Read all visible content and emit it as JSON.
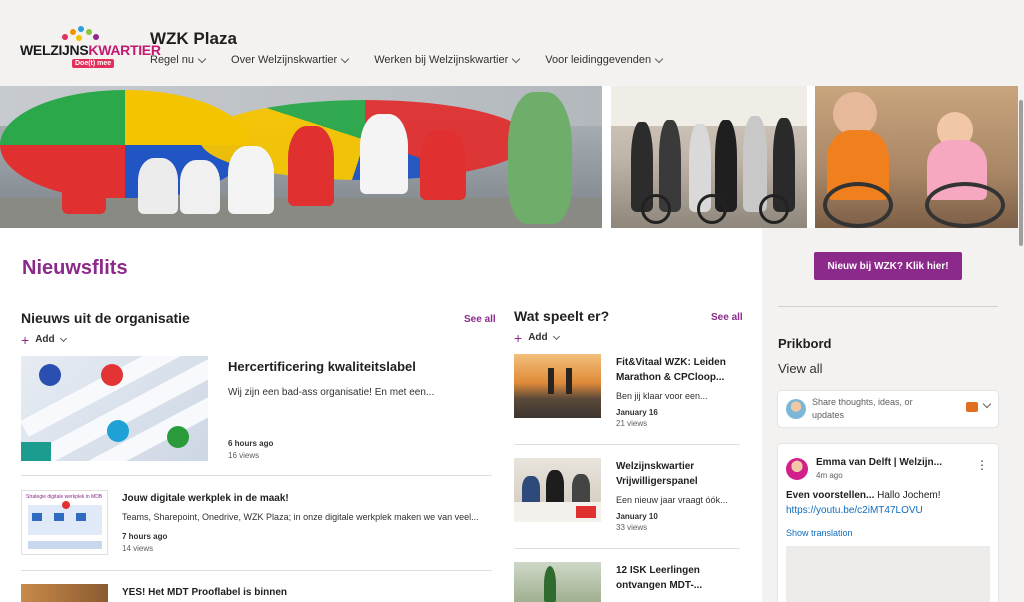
{
  "header": {
    "logo_word_main": "WELZIJNS",
    "logo_word_accent": "KWARTIER",
    "logo_tagline": "Doe(t) mee",
    "site_title": "WZK Plaza",
    "nav": [
      {
        "label": "Regel nu"
      },
      {
        "label": "Over Welzijnskwartier"
      },
      {
        "label": "Werken bij Welzijnskwartier"
      },
      {
        "label": "Voor leidinggevenden"
      }
    ]
  },
  "main": {
    "page_heading": "Nieuwsflits",
    "news": {
      "title": "Nieuws uit de organisatie",
      "see_all": "See all",
      "add_label": "Add",
      "featured": {
        "title": "Hercertificering kwaliteitslabel",
        "description": "Wij zijn een bad-ass organisatie! En met een...",
        "time": "6 hours ago",
        "views": "16 views"
      },
      "items": [
        {
          "title": "Jouw digitale werkplek in de maak!",
          "description": "Teams, Sharepoint, Onedrive, WZK Plaza; in onze digitale werkplek maken we van veel...",
          "time": "7 hours ago",
          "views": "14 views",
          "thumb_caption": "Strategie digitale werkplek in MDB"
        },
        {
          "title": "YES! Het MDT Prooflabel is binnen"
        }
      ]
    },
    "events": {
      "title": "Wat speelt er?",
      "see_all": "See all",
      "add_label": "Add",
      "items": [
        {
          "title": "Fit&Vitaal WZK: Leiden Marathon & CPCloop...",
          "description": "Ben jij klaar voor een...",
          "date": "January 16",
          "views": "21 views"
        },
        {
          "title": "Welzijnskwartier Vrijwilligerspanel",
          "description": "Een nieuw jaar vraagt óók...",
          "date": "January 10",
          "views": "33 views"
        },
        {
          "title": "12 ISK Leerlingen ontvangen MDT-..."
        }
      ]
    }
  },
  "sidebar": {
    "cta_label": "Nieuw bij WZK? Klik hier!",
    "prikbord_title": "Prikbord",
    "view_all": "View all",
    "share_placeholder": "Share thoughts, ideas, or updates",
    "post": {
      "author": "Emma van Delft | Welzijn...",
      "time": "4m ago",
      "body_bold": "Even voorstellen...",
      "body_text": " Hallo Jochem!",
      "link": "https://youtu.be/c2iMT47LOVU",
      "translate": "Show translation"
    }
  },
  "colors": {
    "brand_purple": "#8b2a8a",
    "link_blue": "#0f6cbd",
    "header_bg": "#f3f2f1"
  },
  "icons": [
    "chevron-down-icon",
    "plus-icon",
    "more-icon",
    "comment-icon"
  ]
}
